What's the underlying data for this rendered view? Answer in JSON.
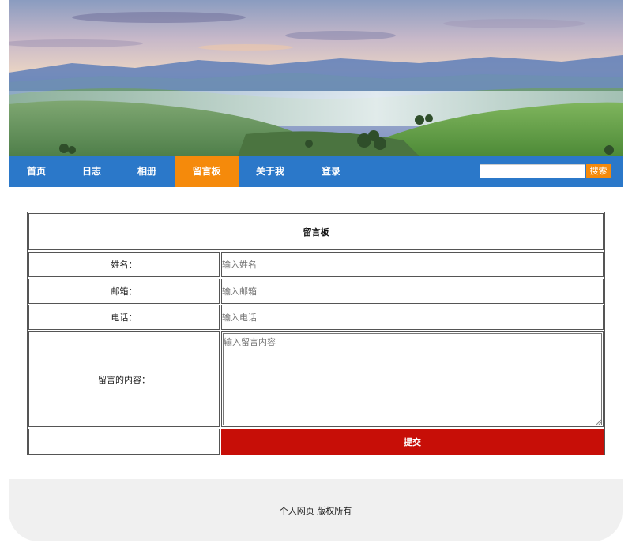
{
  "nav": {
    "items": [
      {
        "label": "首页"
      },
      {
        "label": "日志"
      },
      {
        "label": "相册"
      },
      {
        "label": "留言板"
      },
      {
        "label": "关于我"
      },
      {
        "label": "登录"
      }
    ],
    "active": "留言板",
    "search": {
      "placeholder": "",
      "value": "",
      "button_label": "搜索"
    }
  },
  "form": {
    "title": "留言板",
    "rows": {
      "name": {
        "label": "姓名：",
        "placeholder": "输入姓名"
      },
      "email": {
        "label": "邮箱：",
        "placeholder": "输入邮箱"
      },
      "phone": {
        "label": "电话：",
        "placeholder": "输入电话"
      },
      "message": {
        "label": "留言的内容：",
        "placeholder": "输入留言内容"
      }
    },
    "submit_label": "提交"
  },
  "footer": {
    "text": "个人网页 版权所有"
  },
  "colors": {
    "nav": "#2b78c9",
    "active": "#f58a0b",
    "submit": "#c70e07",
    "footer_bg": "#f0f0f0"
  },
  "icons": {
    "banner": "landscape-banner-image",
    "resize": "textarea-resize-grip-icon"
  }
}
